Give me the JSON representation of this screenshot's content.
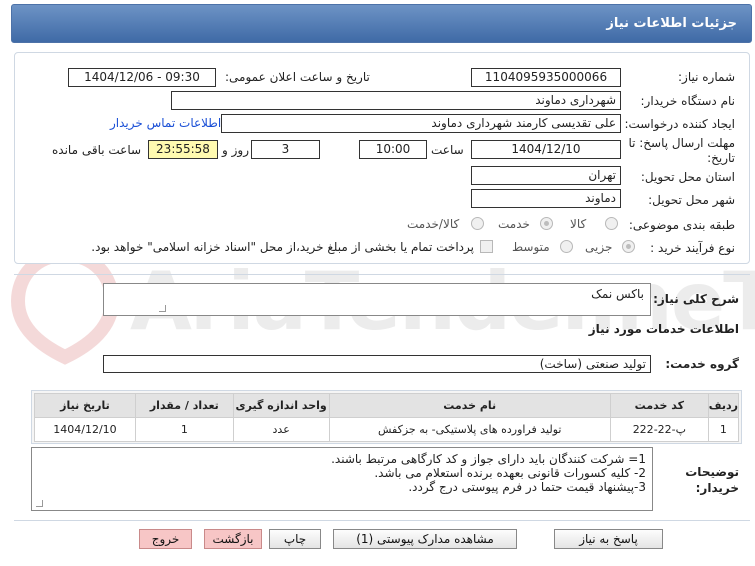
{
  "header": {
    "title": "جزئیات اطلاعات نیاز"
  },
  "form": {
    "need_number": {
      "label": "شماره نیاز:",
      "value": "1104095935000066"
    },
    "announce_datetime": {
      "label": "تاریخ و ساعت اعلان عمومی:",
      "value": "1404/12/06 - 09:30"
    },
    "buyer_org": {
      "label": "نام دستگاه خریدار:",
      "value": "شهرداری دماوند"
    },
    "requester": {
      "label": "ایجاد کننده درخواست:",
      "value": "علی تقدیسی کارمند شهرداری دماوند"
    },
    "contact_link": "اطلاعات تماس خریدار",
    "deadline": {
      "label": "مهلت ارسال پاسخ: تا تاریخ:",
      "date": "1404/12/10",
      "time_label": "ساعت",
      "time": "10:00",
      "days": "3",
      "days_label": "روز و",
      "remaining": "23:55:58",
      "remaining_label": "ساعت باقی مانده"
    },
    "province": {
      "label": "استان محل تحویل:",
      "value": "تهران"
    },
    "city": {
      "label": "شهر محل تحویل:",
      "value": "دماوند"
    },
    "category": {
      "label": "طبقه بندی موضوعی:",
      "options": [
        "کالا",
        "خدمت",
        "کالا/خدمت"
      ],
      "selected": "خدمت"
    },
    "process_type": {
      "label": "نوع فرآیند خرید :",
      "options": [
        "جزیی",
        "متوسط"
      ],
      "selected": "جزیی",
      "payment_note": "پرداخت تمام یا بخشی از مبلغ خرید،از محل \"اسناد خزانه اسلامی\" خواهد بود."
    }
  },
  "summary": {
    "label": "شرح کلی نیاز:",
    "value": "باکس نمک"
  },
  "services_section": {
    "title": "اطلاعات خدمات مورد نیاز"
  },
  "service_group": {
    "label": "گروه خدمت:",
    "value": "تولید صنعتی (ساخت)"
  },
  "table": {
    "headers": [
      "ردیف",
      "کد خدمت",
      "نام خدمت",
      "واحد اندازه گیری",
      "تعداد / مقدار",
      "تاریخ نیاز"
    ],
    "rows": [
      [
        "1",
        "پ-22-222",
        "تولید فراورده های پلاستیکی- به جزکفش",
        "عدد",
        "1",
        "1404/12/10"
      ]
    ]
  },
  "buyer_notes": {
    "label": "توضیحات خریدار:",
    "lines": [
      "1= شرکت کنندگان باید دارای جواز و کد کارگاهی مرتبط باشند.",
      "2- کلیه کسورات قانونی بعهده برنده استعلام می باشد.",
      "3-پیشنهاد قیمت حتما در فرم پیوستی درج گردد."
    ]
  },
  "buttons": {
    "reply": "پاسخ به نیاز",
    "attachments": "مشاهده مدارک پیوستی (1)",
    "print": "چاپ",
    "back": "بازگشت",
    "exit": "خروج"
  },
  "watermark": {
    "text": "AriaTender.neT"
  },
  "colors": {
    "header_bg": "#4f79b3",
    "timer_bg": "#fffab0",
    "link": "#1a4fd6",
    "danger_button": "#f7c6c6"
  }
}
